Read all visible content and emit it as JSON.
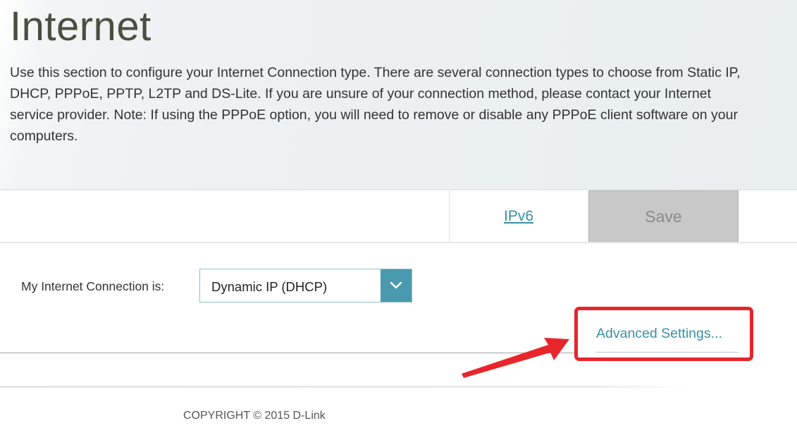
{
  "header": {
    "title": "Internet",
    "description": "Use this section to configure your Internet Connection type. There are several connection types to choose from Static IP, DHCP, PPPoE, PPTP, L2TP and DS-Lite. If you are unsure of your connection method, please contact your Internet service provider. Note: If using the PPPoE option, you will need to remove or disable any PPPoE client software on your computers."
  },
  "toolbar": {
    "ipv6_label": "IPv6",
    "save_label": "Save"
  },
  "connection": {
    "label": "My Internet Connection is:",
    "selected": "Dynamic IP (DHCP)",
    "dropdown_icon": "chevron-down-icon"
  },
  "advanced": {
    "label": "Advanced Settings..."
  },
  "annotation": {
    "highlight_color": "#e8252a",
    "arrow_color": "#e8252a"
  },
  "footer": {
    "copyright": "COPYRIGHT © 2015 D-Link"
  },
  "colors": {
    "accent": "#3a8fa6",
    "dropdown_arrow_bg": "#4a9aaf",
    "save_bg": "#c8c8c8"
  }
}
